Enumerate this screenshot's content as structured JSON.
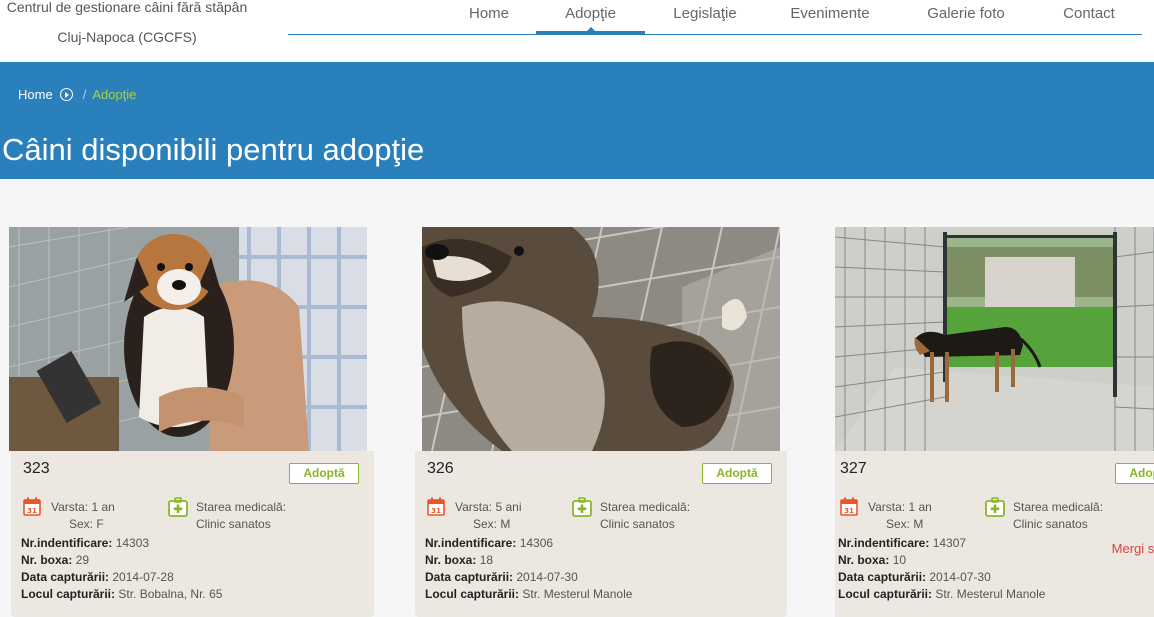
{
  "header": {
    "logo_line1": "Centrul de gestionare câini fără stăpân",
    "logo_line2": "Cluj-Napoca (CGCFS)"
  },
  "nav": {
    "items": [
      {
        "label": "Home",
        "active": false
      },
      {
        "label": "Adopţie",
        "active": true
      },
      {
        "label": "Legislaţie",
        "active": false
      },
      {
        "label": "Evenimente",
        "active": false
      },
      {
        "label": "Galerie foto",
        "active": false
      },
      {
        "label": "Contact",
        "active": false
      }
    ]
  },
  "breadcrumb": {
    "home": "Home",
    "separator": "/",
    "current": "Adopţie"
  },
  "page_title": "Câini disponibili pentru adopţie",
  "labels": {
    "adopt": "Adoptă",
    "age_prefix": "Varsta:",
    "sex_prefix": "Sex:",
    "medical_label": "Starea medicală:",
    "id_label": "Nr.indentificare:",
    "box_label": "Nr. boxa:",
    "capture_date_label": "Data capturării:",
    "capture_place_label": "Locul capturării:"
  },
  "dogs": [
    {
      "id": "323",
      "age": "1 an",
      "sex": "F",
      "medical": "Clinic sanatos",
      "ident": "14303",
      "box": "29",
      "capture_date": "2014-07-28",
      "capture_place": "Str. Bobalna, Nr. 65"
    },
    {
      "id": "326",
      "age": "5 ani",
      "sex": "M",
      "medical": "Clinic sanatos",
      "ident": "14306",
      "box": "18",
      "capture_date": "2014-07-30",
      "capture_place": "Str. Mesterul Manole"
    },
    {
      "id": "327",
      "age": "1 an",
      "sex": "M",
      "medical": "Clinic sanatos",
      "ident": "14307",
      "box": "10",
      "capture_date": "2014-07-30",
      "capture_place": "Str. Mesterul Manole"
    }
  ],
  "go_top": "Mergi sus",
  "calendar_day": "31",
  "colors": {
    "banner": "#2a80bb",
    "accent_green": "#8ab526",
    "icon_orange": "#e8572a",
    "go_top_red": "#d9443c",
    "card_bg": "#ece8e1"
  }
}
